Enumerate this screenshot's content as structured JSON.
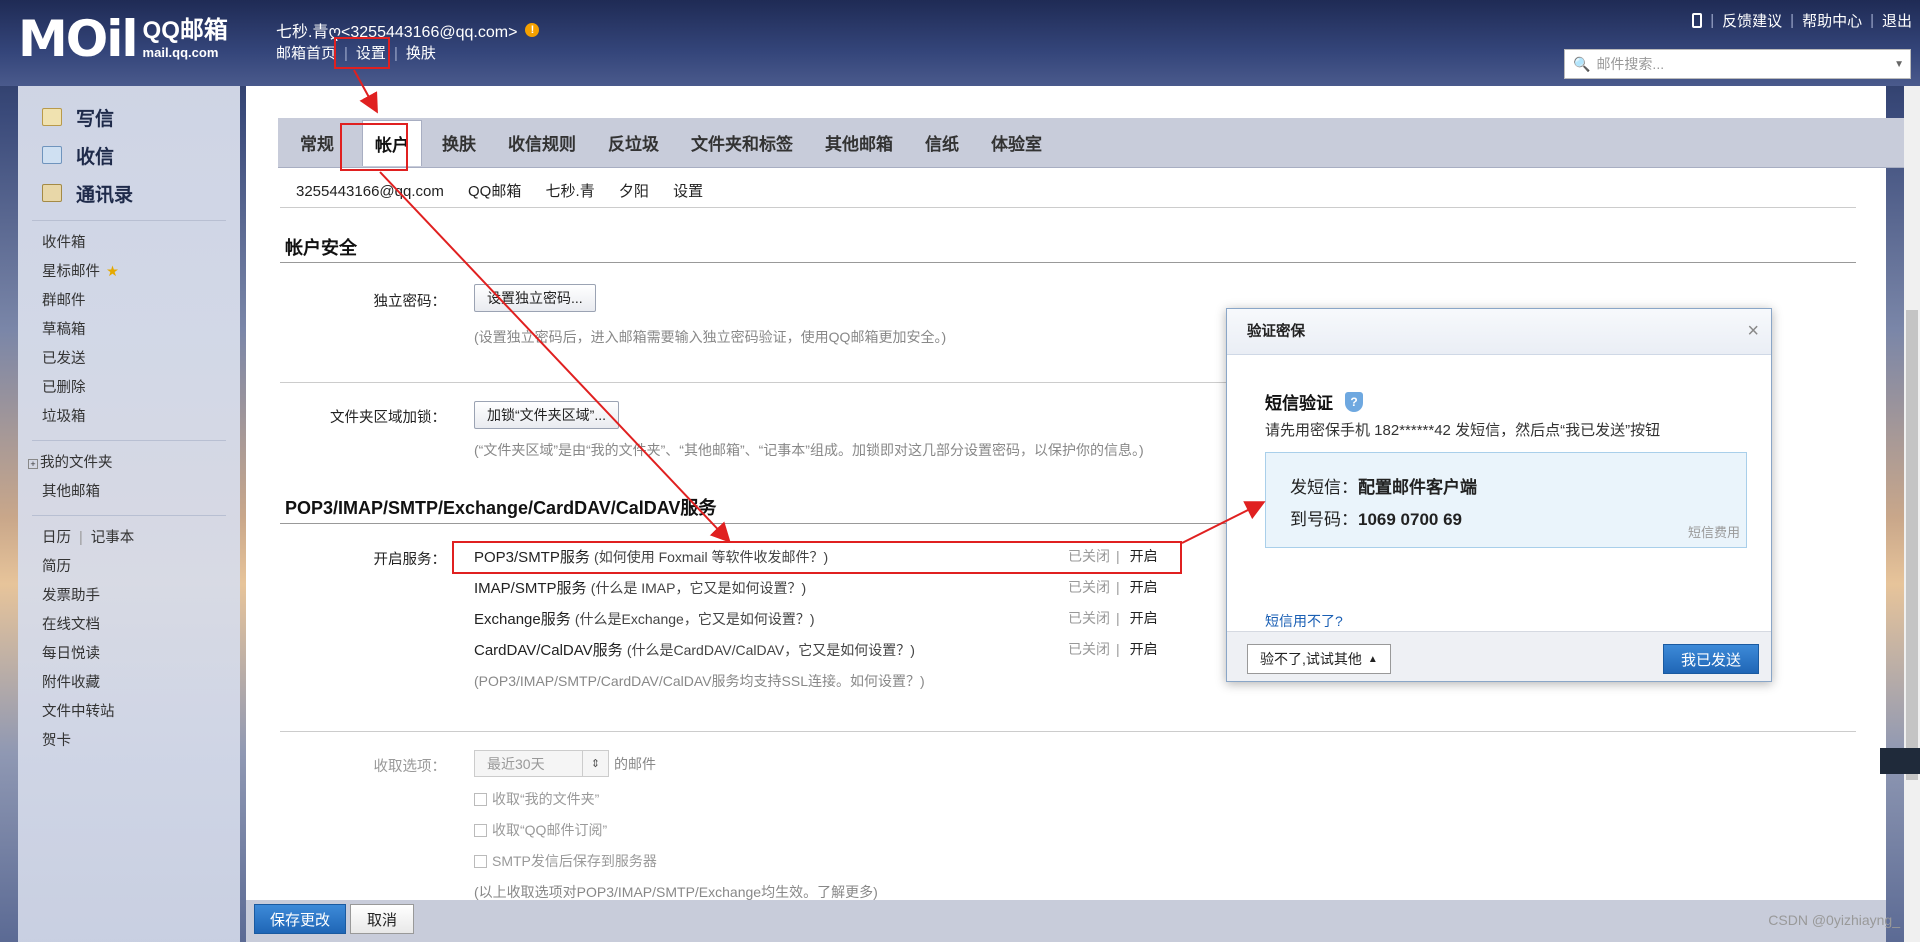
{
  "header": {
    "logo_mark": "MOil",
    "logo_name": "QQ邮箱",
    "logo_domain": "mail.qq.com",
    "user": "七秒.青ღ<3255443166@qq.com>",
    "warn": "!",
    "nav": [
      "邮箱首页",
      "设置",
      "换肤"
    ],
    "right_links": [
      "反馈建议",
      "帮助中心",
      "退出"
    ],
    "search_placeholder": "邮件搜索..."
  },
  "sidebar": {
    "compose": "写信",
    "inbox_big": "收信",
    "contacts": "通讯录",
    "folders": [
      "收件箱",
      "星标邮件",
      "群邮件",
      "草稿箱",
      "已发送",
      "已删除",
      "垃圾箱"
    ],
    "my_folders": "我的文件夹",
    "other_mail": "其他邮箱",
    "tools_row": [
      "日历",
      "记事本"
    ],
    "tools": [
      "简历",
      "发票助手",
      "在线文档",
      "每日悦读",
      "附件收藏",
      "文件中转站",
      "贺卡"
    ]
  },
  "tabs": [
    "常规",
    "帐户",
    "换肤",
    "收信规则",
    "反垃圾",
    "文件夹和标签",
    "其他邮箱",
    "信纸",
    "体验室"
  ],
  "account_line": [
    "3255443166@qq.com",
    "QQ邮箱",
    "七秒.青",
    "夕阳",
    "设置"
  ],
  "security": {
    "title": "帐户安全",
    "pwd_label": "独立密码：",
    "pwd_button": "设置独立密码...",
    "pwd_hint": "(设置独立密码后，进入邮箱需要输入独立密码验证，使用QQ邮箱更加安全。)",
    "lock_label": "文件夹区域加锁：",
    "lock_button": "加锁“文件夹区域”...",
    "lock_hint": "(“文件夹区域”是由“我的文件夹”、“其他邮箱”、“记事本”组成。加锁即对这几部分设置密码，以保护你的信息。)"
  },
  "services": {
    "title": "POP3/IMAP/SMTP/Exchange/CardDAV/CalDAV服务",
    "label": "开启服务：",
    "items": [
      {
        "name": "POP3/SMTP服务",
        "q": "(如何使用 Foxmail 等软件收发邮件？)",
        "off": "已关闭",
        "on": "开启"
      },
      {
        "name": "IMAP/SMTP服务",
        "q": "(什么是 IMAP，它又是如何设置？)",
        "off": "已关闭",
        "on": "开启"
      },
      {
        "name": "Exchange服务",
        "q": "(什么是Exchange，它又是如何设置？)",
        "off": "已关闭",
        "on": "开启"
      },
      {
        "name": "CardDAV/CalDAV服务",
        "q": "(什么是CardDAV/CalDAV，它又是如何设置？)",
        "off": "已关闭",
        "on": "开启"
      }
    ],
    "ssl_hint": "(POP3/IMAP/SMTP/CardDAV/CalDAV服务均支持SSL连接。如何设置？)"
  },
  "receive": {
    "label": "收取选项：",
    "select_value": "最近30天",
    "suffix": "的邮件",
    "checks": [
      "收取“我的文件夹”",
      "收取“QQ邮件订阅”",
      "SMTP发信后保存到服务器"
    ],
    "note": "(以上收取选项对POP3/IMAP/SMTP/Exchange均生效。了解更多)"
  },
  "footer": {
    "save": "保存更改",
    "cancel": "取消"
  },
  "dialog": {
    "title": "验证密保",
    "close": "×",
    "heading": "短信验证",
    "desc": "请先用密保手机 182******42 发短信，然后点“我已发送”按钮",
    "send_label": "发短信：",
    "send_value": "配置邮件客户端",
    "to_label": "到号码：",
    "to_value": "1069 0700 69",
    "fee": "短信费用",
    "link": "短信用不了?",
    "alt_button": "验不了,试试其他",
    "sent_button": "我已发送"
  },
  "watermark": "CSDN @0yizhiayng_"
}
